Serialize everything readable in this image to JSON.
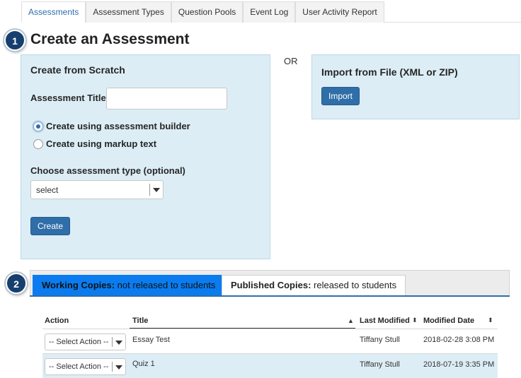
{
  "top_tabs": [
    {
      "label": "Assessments",
      "active": true
    },
    {
      "label": "Assessment Types",
      "active": false
    },
    {
      "label": "Question Pools",
      "active": false
    },
    {
      "label": "Event Log",
      "active": false
    },
    {
      "label": "User Activity Report",
      "active": false
    }
  ],
  "steps": {
    "one": "1",
    "two": "2"
  },
  "page_title": "Create an Assessment",
  "scratch": {
    "title": "Create from Scratch",
    "assessment_title_label": "Assessment Title",
    "assessment_title_value": "",
    "radio_builder": "Create using assessment builder",
    "radio_markup": "Create using markup text",
    "type_label": "Choose assessment type (optional)",
    "type_select": "select",
    "create_button": "Create"
  },
  "or_text": "OR",
  "import": {
    "title": "Import from File (XML or ZIP)",
    "button": "Import"
  },
  "copies_tabs": {
    "working": {
      "bold": "Working Copies:",
      "rest": " not released to students"
    },
    "published": {
      "bold": "Published Copies:",
      "rest": " released to students"
    }
  },
  "table": {
    "headers": {
      "action": "Action",
      "title": "Title",
      "last_modified": "Last Modified",
      "modified_date": "Modified Date"
    },
    "sort_up_icon": "▲",
    "sort_both_icon": "⬍",
    "rows": [
      {
        "action": "-- Select Action --",
        "title": "Essay Test",
        "last_modified": "Tiffany Stull",
        "modified_date": "2018-02-28 3:08 PM"
      },
      {
        "action": "-- Select Action --",
        "title": "Quiz 1",
        "last_modified": "Tiffany Stull",
        "modified_date": "2018-07-19 3:35 PM"
      }
    ]
  },
  "colors": {
    "accent": "#2f6ea8",
    "panel": "#dcedf5",
    "active_tab": "#0a7cf0",
    "badge": "#163f6e"
  }
}
